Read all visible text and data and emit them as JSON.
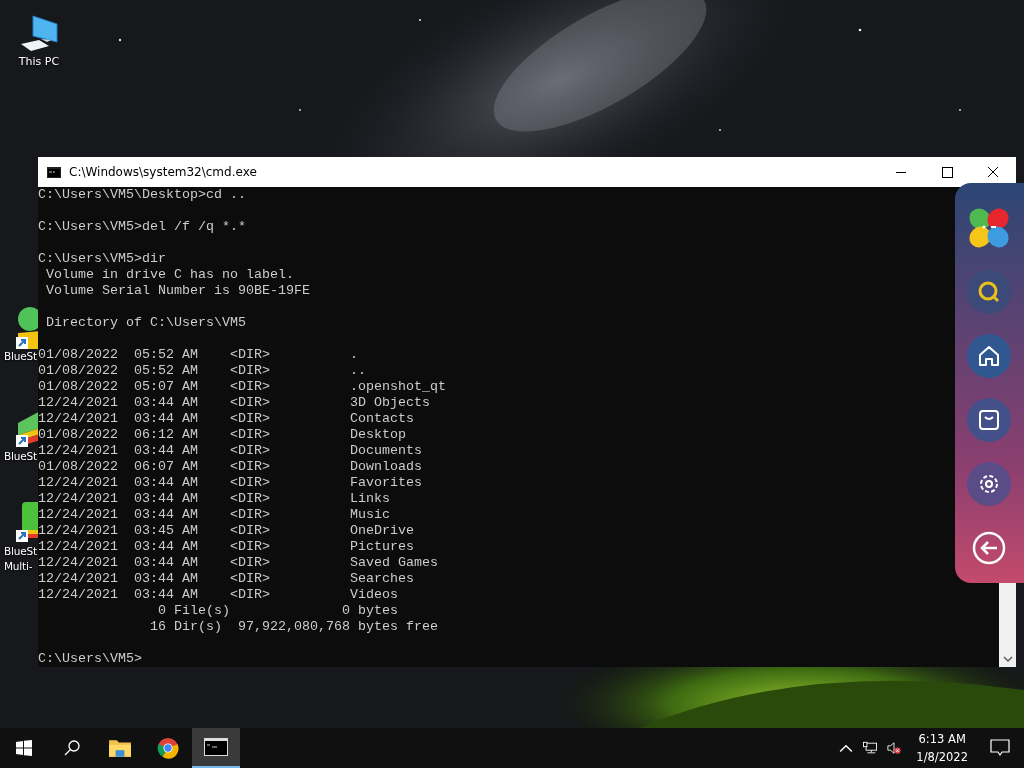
{
  "desktop_icons": [
    {
      "kind": "computer",
      "label_lines": [
        "This PC"
      ]
    },
    {
      "kind": "bluestacks",
      "label_lines": [
        "BlueSt"
      ]
    },
    {
      "kind": "bluestacks-stack",
      "label_lines": [
        "BlueSt"
      ]
    },
    {
      "kind": "bluestacks-multi",
      "label_lines": [
        "BlueSt",
        "Multi-"
      ]
    }
  ],
  "window": {
    "title": "C:\\Windows\\system32\\cmd.exe",
    "console_blocks": [
      [
        "C:\\Users\\VM5\\Desktop>cd .."
      ],
      [
        "C:\\Users\\VM5>del /f /q *.*"
      ],
      [
        "C:\\Users\\VM5>dir",
        " Volume in drive C has no label.",
        " Volume Serial Number is 90BE-19FE"
      ],
      [
        " Directory of C:\\Users\\VM5"
      ],
      [
        "01/08/2022  05:52 AM    <DIR>          .",
        "01/08/2022  05:52 AM    <DIR>          ..",
        "01/08/2022  05:07 AM    <DIR>          .openshot_qt",
        "12/24/2021  03:44 AM    <DIR>          3D Objects",
        "12/24/2021  03:44 AM    <DIR>          Contacts",
        "01/08/2022  06:12 AM    <DIR>          Desktop",
        "12/24/2021  03:44 AM    <DIR>          Documents",
        "01/08/2022  06:07 AM    <DIR>          Downloads",
        "12/24/2021  03:44 AM    <DIR>          Favorites",
        "12/24/2021  03:44 AM    <DIR>          Links",
        "12/24/2021  03:44 AM    <DIR>          Music",
        "12/24/2021  03:45 AM    <DIR>          OneDrive",
        "12/24/2021  03:44 AM    <DIR>          Pictures",
        "12/24/2021  03:44 AM    <DIR>          Saved Games",
        "12/24/2021  03:44 AM    <DIR>          Searches",
        "12/24/2021  03:44 AM    <DIR>          Videos",
        "               0 File(s)              0 bytes",
        "              16 Dir(s)  97,922,080,768 bytes free"
      ],
      [
        "C:\\Users\\VM5>"
      ]
    ]
  },
  "side_panel": [
    {
      "kind": "logo"
    },
    {
      "kind": "search"
    },
    {
      "kind": "home"
    },
    {
      "kind": "store"
    },
    {
      "kind": "settings"
    },
    {
      "kind": "back"
    }
  ],
  "taskbar": {
    "apps": [
      {
        "kind": "start",
        "selected": false
      },
      {
        "kind": "search",
        "selected": false
      },
      {
        "kind": "files",
        "selected": false
      },
      {
        "kind": "browser",
        "selected": false
      },
      {
        "kind": "terminal",
        "selected": true
      }
    ],
    "tray": {
      "time": "6:13 AM",
      "date": "1/8/2022",
      "volume_muted": true
    }
  }
}
